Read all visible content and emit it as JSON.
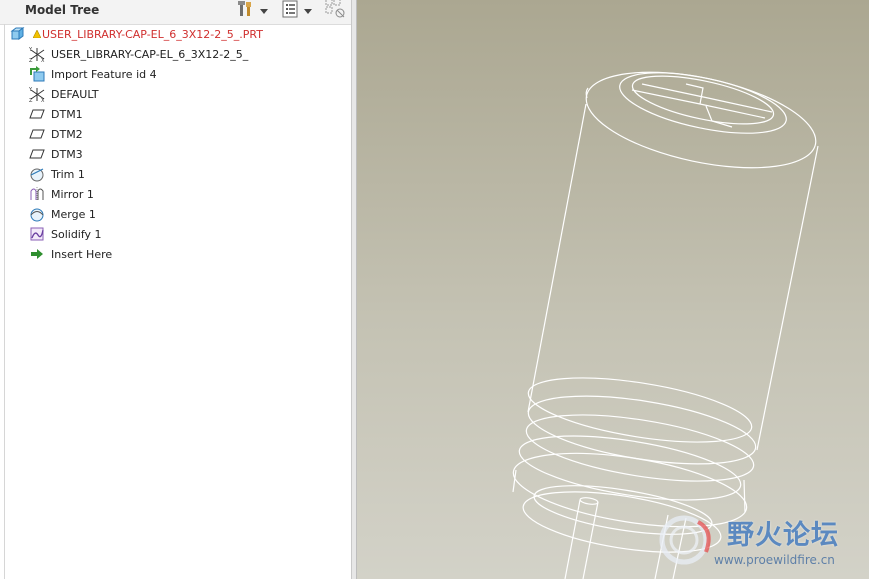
{
  "panel": {
    "title": "Model Tree"
  },
  "tree": {
    "root_label": "USER_LIBRARY-CAP-EL_6_3X12-2_5_.PRT",
    "items": [
      {
        "label": "USER_LIBRARY-CAP-EL_6_3X12-2_5_",
        "icon": "coordinate-system-icon"
      },
      {
        "label": "Import Feature id 4",
        "icon": "import-feature-icon"
      },
      {
        "label": "DEFAULT",
        "icon": "coordinate-system-icon"
      },
      {
        "label": "DTM1",
        "icon": "datum-plane-icon"
      },
      {
        "label": "DTM2",
        "icon": "datum-plane-icon"
      },
      {
        "label": "DTM3",
        "icon": "datum-plane-icon"
      },
      {
        "label": "Trim 1",
        "icon": "trim-icon"
      },
      {
        "label": "Mirror 1",
        "icon": "mirror-icon"
      },
      {
        "label": "Merge 1",
        "icon": "merge-icon"
      },
      {
        "label": "Solidify 1",
        "icon": "solidify-icon"
      },
      {
        "label": "Insert Here",
        "icon": "insert-arrow-icon"
      }
    ]
  },
  "watermark": {
    "text_cn": "野火论坛",
    "url": "www.proewildfire.cn"
  },
  "colors": {
    "root_text": "#d0302f",
    "viewport_top": "#aba791",
    "viewport_bottom": "#d3d2c8",
    "model_lines": "#ffffff"
  }
}
